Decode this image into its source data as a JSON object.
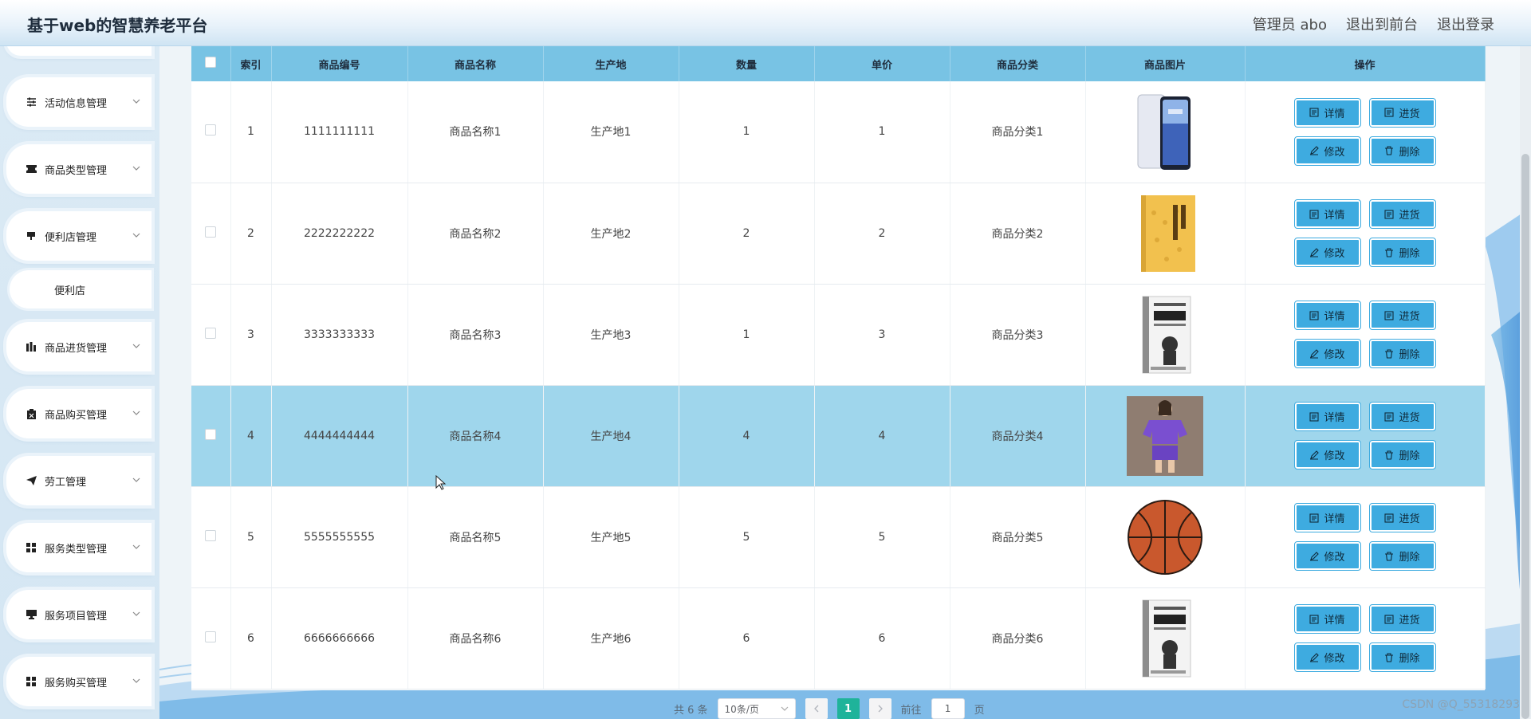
{
  "header": {
    "title": "基于web的智慧养老平台",
    "user": "管理员 abo",
    "to_front": "退出到前台",
    "logout": "退出登录"
  },
  "sidebar": {
    "items": [
      {
        "label": "活动信息管理",
        "icon": "sliders-icon"
      },
      {
        "label": "商品类型管理",
        "icon": "ticket-icon"
      },
      {
        "label": "便利店管理",
        "icon": "shop-icon"
      },
      {
        "label": "商品进货管理",
        "icon": "chart-bars-icon"
      },
      {
        "label": "商品购买管理",
        "icon": "clipboard-icon"
      },
      {
        "label": "劳工管理",
        "icon": "send-icon"
      },
      {
        "label": "服务类型管理",
        "icon": "grid-icon"
      },
      {
        "label": "服务项目管理",
        "icon": "monitor-icon"
      },
      {
        "label": "服务购买管理",
        "icon": "grid-icon"
      }
    ],
    "submenu": {
      "label": "便利店"
    }
  },
  "table": {
    "columns": [
      "",
      "索引",
      "商品编号",
      "商品名称",
      "生产地",
      "数量",
      "单价",
      "商品分类",
      "商品图片",
      "操作"
    ],
    "rows": [
      {
        "index": "1",
        "code": "1111111111",
        "name": "商品名称1",
        "origin": "生产地1",
        "qty": "1",
        "price": "1",
        "category": "商品分类1",
        "image": "phone"
      },
      {
        "index": "2",
        "code": "2222222222",
        "name": "商品名称2",
        "origin": "生产地2",
        "qty": "2",
        "price": "2",
        "category": "商品分类2",
        "image": "yellow-book"
      },
      {
        "index": "3",
        "code": "3333333333",
        "name": "商品名称3",
        "origin": "生产地3",
        "qty": "1",
        "price": "3",
        "category": "商品分类3",
        "image": "gray-book"
      },
      {
        "index": "4",
        "code": "4444444444",
        "name": "商品名称4",
        "origin": "生产地4",
        "qty": "4",
        "price": "4",
        "category": "商品分类4",
        "image": "purple-outfit"
      },
      {
        "index": "5",
        "code": "5555555555",
        "name": "商品名称5",
        "origin": "生产地5",
        "qty": "5",
        "price": "5",
        "category": "商品分类5",
        "image": "basketball"
      },
      {
        "index": "6",
        "code": "6666666666",
        "name": "商品名称6",
        "origin": "生产地6",
        "qty": "6",
        "price": "6",
        "category": "商品分类6",
        "image": "gray-book"
      }
    ],
    "buttons": {
      "detail": "详情",
      "stock": "进货",
      "edit": "修改",
      "delete": "删除"
    },
    "active_row": 3
  },
  "pagination": {
    "total": "共 6 条",
    "page_size": "10条/页",
    "current": "1",
    "goto_label": "前往",
    "goto_value": "1",
    "page_unit": "页"
  },
  "watermark": "CSDN @Q_55318293",
  "colors": {
    "header_bg": "#e8f2fa",
    "table_header": "#78c3e4",
    "active_row": "#9fd6ec",
    "button": "#3eabe0",
    "page_active": "#1fb39a"
  }
}
